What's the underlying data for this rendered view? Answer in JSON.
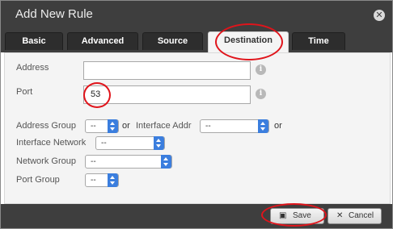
{
  "dialog": {
    "title": "Add New Rule",
    "close_icon": "close-icon"
  },
  "tabs": [
    {
      "label": "Basic",
      "active": false
    },
    {
      "label": "Advanced",
      "active": false
    },
    {
      "label": "Source",
      "active": false
    },
    {
      "label": "Destination",
      "active": true
    },
    {
      "label": "Time",
      "active": false
    }
  ],
  "form": {
    "address": {
      "label": "Address",
      "value": ""
    },
    "port": {
      "label": "Port",
      "value": "53"
    },
    "address_group": {
      "label": "Address Group",
      "value": "--"
    },
    "or_1": "or",
    "interface_addr": {
      "label": "Interface Addr",
      "value": "--"
    },
    "or_2": "or",
    "interface_network": {
      "label": "Interface Network",
      "value": "--"
    },
    "network_group": {
      "label": "Network Group",
      "value": "--"
    },
    "port_group": {
      "label": "Port Group",
      "value": "--"
    }
  },
  "footer": {
    "save_label": "Save",
    "cancel_label": "Cancel",
    "save_icon": "floppy-disk-icon",
    "cancel_icon": "x-icon"
  },
  "annotations": {
    "highlighted": [
      "Destination tab",
      "Port value",
      "Save button"
    ],
    "color": "#e0141b"
  },
  "colors": {
    "header": "#3e3e3e",
    "select_accent": "#3b7ede",
    "panel": "#f4f4f4"
  }
}
